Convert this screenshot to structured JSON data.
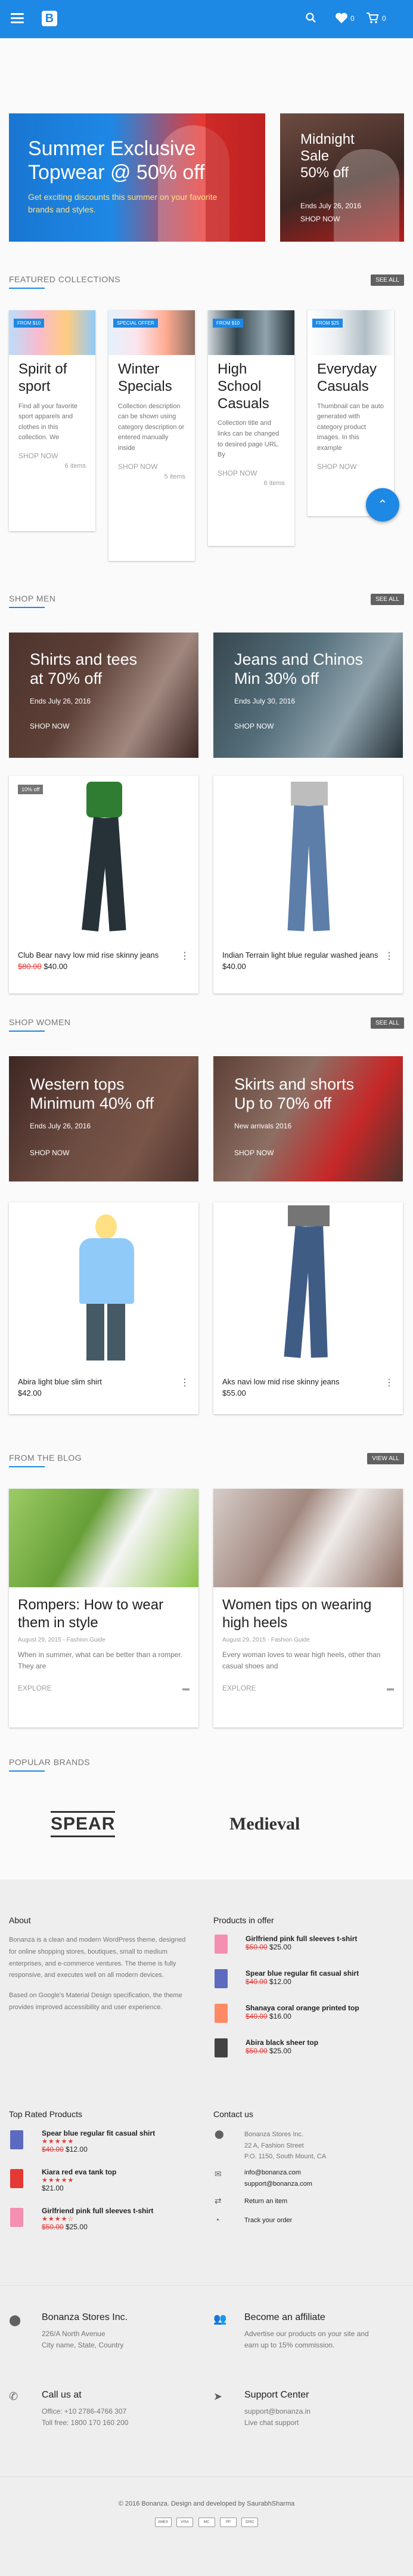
{
  "header": {
    "logo_letter": "B",
    "wishlist_count": "0",
    "cart_count": "0",
    "icons": [
      "menu-icon",
      "search-icon",
      "heart-icon",
      "cart-icon"
    ],
    "brand_color": "#1e88e5"
  },
  "banners": {
    "main": {
      "title_a": "Summer Exclusive",
      "title_b": "Topwear @ 50% off",
      "subtitle": "Get exciting discounts this summer on your favorite brands and styles."
    },
    "side": {
      "title_a": "Midnight",
      "title_b": "Sale",
      "title_c": "50% off",
      "date": "Ends July 26, 2016",
      "cta": "SHOP NOW"
    }
  },
  "featured": {
    "heading": "FEATURED COLLECTIONS",
    "see_all": "SEE ALL",
    "cards": [
      {
        "badge": "FROM $10",
        "title": "Spirit of sport",
        "desc": "Find all your favorite sport apparels and clothes in this collection. We",
        "shop": "SHOP NOW",
        "items": "6 items"
      },
      {
        "badge": "SPECIAL OFFER",
        "title": "Winter Specials",
        "desc": "Collection description can be shown using category description or entered manually inside",
        "shop": "SHOP NOW",
        "items": "5 items"
      },
      {
        "badge": "FROM $10",
        "title": "High School Casuals",
        "desc": "Collection title and links can be changed to desired page URL. By",
        "shop": "SHOP NOW",
        "items": "6 items"
      },
      {
        "badge": "FROM $25",
        "title": "Everyday Casuals",
        "desc": "Thumbnail can be auto generated with category product images. In this example",
        "shop": "SHOP NOW",
        "items": ""
      }
    ]
  },
  "shop_men": {
    "heading": "SHOP MEN",
    "see_all": "SEE ALL",
    "promo": [
      {
        "title_a": "Shirts and tees",
        "title_b": "at 70% off",
        "date": "Ends July 26, 2016",
        "cta": "SHOP NOW"
      },
      {
        "title_a": "Jeans and Chinos",
        "title_b": "Min 30% off",
        "date": "Ends July 30, 2016",
        "cta": "SHOP NOW"
      }
    ],
    "products": [
      {
        "badge": "10% off",
        "name": "Club Bear navy low mid rise skinny jeans",
        "old_price": "$80.00",
        "price": "$40.00"
      },
      {
        "badge": "",
        "name": "Indian Terrain light blue regular washed jeans",
        "old_price": "",
        "price": "$40.00"
      }
    ]
  },
  "shop_women": {
    "heading": "SHOP WOMEN",
    "see_all": "SEE ALL",
    "promo": [
      {
        "title_a": "Western tops",
        "title_b": "Minimum 40% off",
        "date": "Ends July 26, 2016",
        "cta": "SHOP NOW"
      },
      {
        "title_a": "Skirts and shorts",
        "title_b": "Up to 70% off",
        "date": "New arrivals 2016",
        "cta": "SHOP NOW"
      }
    ],
    "products": [
      {
        "name": "Abira light blue slim shirt",
        "price": "$42.00"
      },
      {
        "name": "Aks navi low mid rise skinny jeans",
        "price": "$55.00"
      }
    ]
  },
  "blog": {
    "heading": "FROM THE BLOG",
    "view_all": "VIEW ALL",
    "posts": [
      {
        "title": "Rompers: How to wear them in style",
        "meta": "August 29, 2015 - Fashion Guide",
        "excerpt": "When in summer, what can be better than a romper. They are",
        "cta": "EXPLORE"
      },
      {
        "title": "Women tips on wearing high heels",
        "meta": "August 29, 2015 - Fashion Guide",
        "excerpt": "Every woman loves to wear high heels, other than casual shoes and",
        "cta": "EXPLORE"
      }
    ]
  },
  "brands": {
    "heading": "POPULAR BRANDS",
    "items": [
      "SPEAR",
      "Medieval"
    ]
  },
  "footer": {
    "about_heading": "About",
    "about_p1": "Bonanza is a clean and modern WordPress theme, designed for online shopping stores, boutiques, small to medium enterprises, and e-commerce ventures. The theme is fully responsive, and executes well on all modern devices.",
    "about_p2": "Based on Google's Material Design specification, the theme provides improved accessibility and user experience.",
    "offer_heading": "Products in offer",
    "offer": [
      {
        "name": "Girlfriend pink full sleeves t-shirt",
        "old": "$50.00",
        "price": "$25.00"
      },
      {
        "name": "Spear blue regular fit casual shirt",
        "old": "$40.00",
        "price": "$12.00"
      },
      {
        "name": "Shanaya coral orange printed top",
        "old": "$40.00",
        "price": "$16.00"
      },
      {
        "name": "Abira black sheer top",
        "old": "$50.00",
        "price": "$25.00"
      }
    ],
    "top_heading": "Top Rated Products",
    "top": [
      {
        "name": "Spear blue regular fit casual shirt",
        "stars": "★★★★★",
        "old": "$40.00",
        "price": "$12.00"
      },
      {
        "name": "Kiara red eva tank top",
        "stars": "★★★★★",
        "old": "",
        "price": "$21.00"
      },
      {
        "name": "Girlfriend pink full sleeves t-shirt",
        "stars": "★★★★☆",
        "old": "$50.00",
        "price": "$25.00"
      }
    ],
    "contact_heading": "Contact us",
    "contact": {
      "address": [
        "Bonanza Stores Inc.",
        "22 A, Fashion Street",
        "P.O. 1150, South Mount, CA"
      ],
      "emails": [
        "info@bonanza.com",
        "support@bonanza.com"
      ],
      "return": "Return an item",
      "track": "Track your order"
    },
    "bottom": [
      {
        "title": "Bonanza Stores Inc.",
        "lines": [
          "226/A North Avenue",
          "City name, State, Country"
        ]
      },
      {
        "title": "Become an affiliate",
        "lines": [
          "Advertise our products on your site and",
          "earn up to 15% commission."
        ]
      },
      {
        "title": "Call us at",
        "lines": [
          "Office: +10 2786-4766 307",
          "Toll free: 1800 170 160 200"
        ]
      },
      {
        "title": "Support Center",
        "lines": [
          "support@bonanza.in",
          "Live chat support"
        ]
      }
    ],
    "copyright": "© 2016 Bonanza. Design and developed by SaurabhSharma",
    "payments": [
      "AMEX",
      "VISA",
      "MC",
      "PP",
      "DISC"
    ]
  }
}
